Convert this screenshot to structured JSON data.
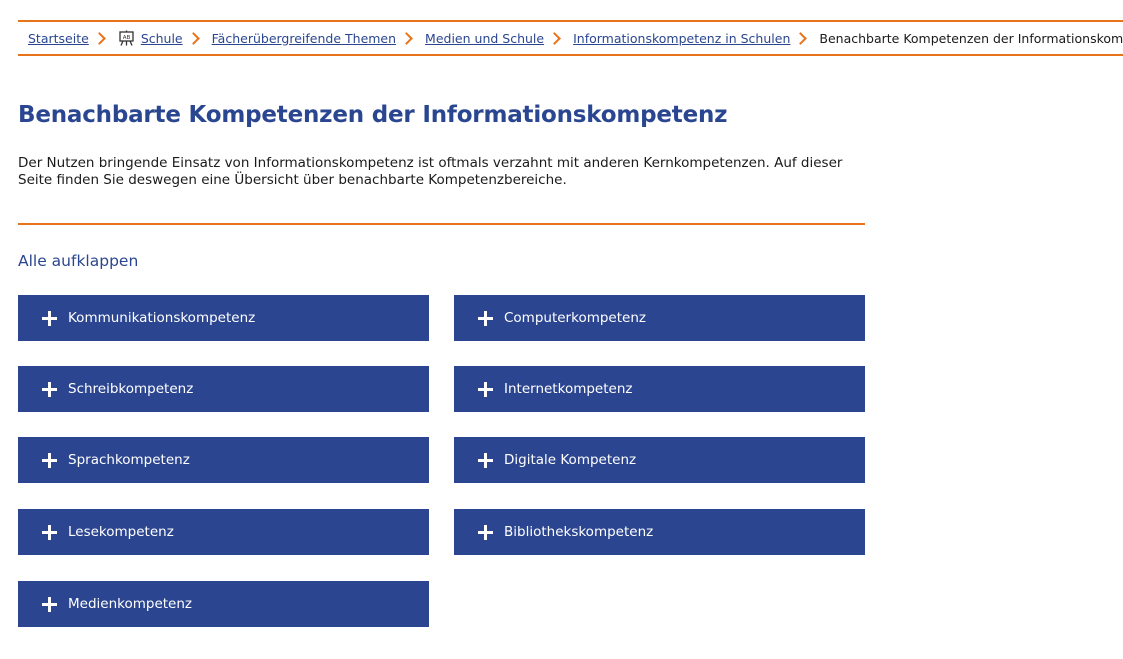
{
  "breadcrumb": {
    "items": [
      {
        "label": "Startseite"
      },
      {
        "label": "Schule",
        "icon": "school-board-icon"
      },
      {
        "label": "Fächerübergreifende Themen"
      },
      {
        "label": "Medien und Schule"
      },
      {
        "label": "Informationskompetenz in Schulen"
      }
    ],
    "current": "Benachbarte Kompetenzen der Informationskompetenz"
  },
  "page": {
    "title": "Benachbarte Kompetenzen der Informationskompetenz",
    "intro": "Der Nutzen bringende Einsatz von Informationskompetenz ist oftmals verzahnt mit anderen Kernkompetenzen. Auf dieser Seite finden Sie deswegen eine Übersicht über benachbarte Kompetenzbereiche.",
    "expand_all": "Alle aufklappen"
  },
  "accordions": {
    "left": [
      {
        "label": "Kommunikationskompetenz"
      },
      {
        "label": "Schreibkompetenz"
      },
      {
        "label": "Sprachkompetenz"
      },
      {
        "label": "Lesekompetenz"
      },
      {
        "label": "Medienkompetenz"
      }
    ],
    "right": [
      {
        "label": "Computerkompetenz"
      },
      {
        "label": "Internetkompetenz"
      },
      {
        "label": "Digitale Kompetenz"
      },
      {
        "label": "Bibliothekskompetenz"
      }
    ]
  },
  "colors": {
    "accent_orange": "#e8731a",
    "brand_blue": "#2b4590",
    "link_blue": "#2a4690"
  }
}
